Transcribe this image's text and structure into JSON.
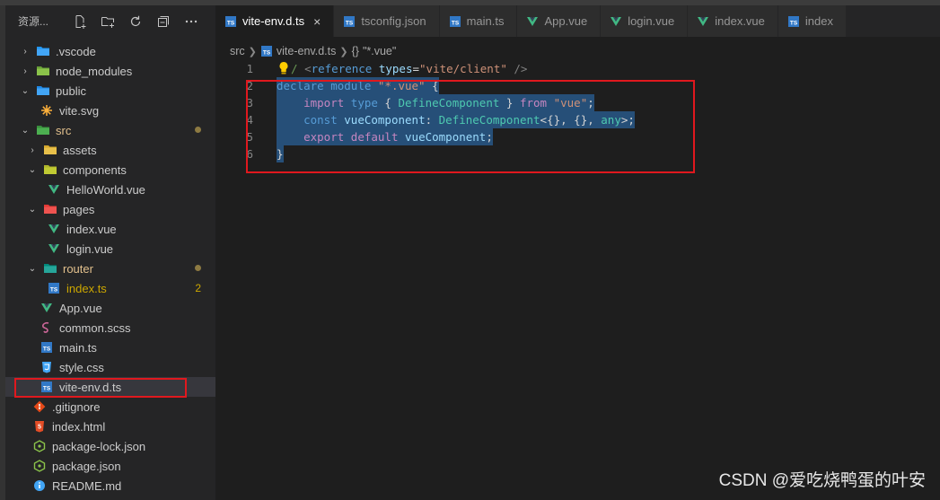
{
  "sidebar": {
    "title": "资源...",
    "tree": [
      {
        "label": ".vscode",
        "chev": "›",
        "depth": 0,
        "icon": "folder-vscode-icon",
        "status": ""
      },
      {
        "label": "node_modules",
        "chev": "›",
        "depth": 0,
        "icon": "folder-node-icon",
        "status": ""
      },
      {
        "label": "public",
        "chev": "⌄",
        "depth": 0,
        "icon": "folder-public-icon",
        "status": ""
      },
      {
        "label": "vite.svg",
        "chev": "",
        "depth": 1,
        "icon": "svg-file-icon",
        "status": ""
      },
      {
        "label": "src",
        "chev": "⌄",
        "depth": 0,
        "icon": "folder-src-icon",
        "status": "dot"
      },
      {
        "label": "assets",
        "chev": "›",
        "depth": 1,
        "icon": "folder-icon",
        "status": ""
      },
      {
        "label": "components",
        "chev": "⌄",
        "depth": 1,
        "icon": "folder-components-icon",
        "status": ""
      },
      {
        "label": "HelloWorld.vue",
        "chev": "",
        "depth": 2,
        "icon": "vue-file-icon",
        "status": ""
      },
      {
        "label": "pages",
        "chev": "⌄",
        "depth": 1,
        "icon": "folder-pages-icon",
        "status": ""
      },
      {
        "label": "index.vue",
        "chev": "",
        "depth": 2,
        "icon": "vue-file-icon",
        "status": ""
      },
      {
        "label": "login.vue",
        "chev": "",
        "depth": 2,
        "icon": "vue-file-icon",
        "status": ""
      },
      {
        "label": "router",
        "chev": "⌄",
        "depth": 1,
        "icon": "folder-router-icon",
        "status": "dot"
      },
      {
        "label": "index.ts",
        "chev": "",
        "depth": 2,
        "icon": "ts-file-icon",
        "status": "2"
      },
      {
        "label": "App.vue",
        "chev": "",
        "depth": 1,
        "icon": "vue-file-icon",
        "status": ""
      },
      {
        "label": "common.scss",
        "chev": "",
        "depth": 1,
        "icon": "scss-file-icon",
        "status": ""
      },
      {
        "label": "main.ts",
        "chev": "",
        "depth": 1,
        "icon": "ts-file-icon",
        "status": ""
      },
      {
        "label": "style.css",
        "chev": "",
        "depth": 1,
        "icon": "css-file-icon",
        "status": ""
      },
      {
        "label": "vite-env.d.ts",
        "chev": "",
        "depth": 1,
        "icon": "ts-file-icon",
        "status": "selected"
      },
      {
        "label": ".gitignore",
        "chev": "",
        "depth": 0,
        "icon": "git-file-icon",
        "status": ""
      },
      {
        "label": "index.html",
        "chev": "",
        "depth": 0,
        "icon": "html-file-icon",
        "status": ""
      },
      {
        "label": "package-lock.json",
        "chev": "",
        "depth": 0,
        "icon": "node-json-icon",
        "status": ""
      },
      {
        "label": "package.json",
        "chev": "",
        "depth": 0,
        "icon": "node-json-icon",
        "status": ""
      },
      {
        "label": "README.md",
        "chev": "",
        "depth": 0,
        "icon": "info-file-icon",
        "status": ""
      }
    ]
  },
  "tabs": [
    {
      "label": "vite-env.d.ts",
      "icon": "ts-file-icon",
      "active": true,
      "close": "×"
    },
    {
      "label": "tsconfig.json",
      "icon": "ts-file-icon",
      "active": false,
      "close": ""
    },
    {
      "label": "main.ts",
      "icon": "ts-file-icon",
      "active": false,
      "close": ""
    },
    {
      "label": "App.vue",
      "icon": "vue-file-icon",
      "active": false,
      "close": ""
    },
    {
      "label": "login.vue",
      "icon": "vue-file-icon",
      "active": false,
      "close": ""
    },
    {
      "label": "index.vue",
      "icon": "vue-file-icon",
      "active": false,
      "close": ""
    },
    {
      "label": "index",
      "icon": "ts-file-icon",
      "active": false,
      "close": ""
    }
  ],
  "breadcrumb": {
    "folder": "src",
    "file": "vite-env.d.ts",
    "symbol_icon": "{}",
    "symbol": "\"*.vue\""
  },
  "editor": {
    "lines": [
      {
        "n": "1",
        "tokens": [
          [
            "cm",
            "/ "
          ],
          [
            "tagc",
            "<"
          ],
          [
            "kw",
            "reference"
          ],
          [
            "punc",
            " "
          ],
          [
            "id",
            "types"
          ],
          [
            "punc",
            "="
          ],
          [
            "str",
            "\"vite/client\""
          ],
          [
            "punc",
            " "
          ],
          [
            "tagc",
            "/>"
          ]
        ],
        "selected": false
      },
      {
        "n": "2",
        "tokens": [
          [
            "kw",
            "declare"
          ],
          [
            "punc",
            " "
          ],
          [
            "kw",
            "module"
          ],
          [
            "punc",
            " "
          ],
          [
            "str",
            "\"*.vue\""
          ],
          [
            "punc",
            " {"
          ]
        ],
        "selected": true
      },
      {
        "n": "3",
        "tokens": [
          [
            "punc",
            "    "
          ],
          [
            "kw2",
            "import"
          ],
          [
            "punc",
            " "
          ],
          [
            "kw",
            "type"
          ],
          [
            "punc",
            " { "
          ],
          [
            "ty",
            "DefineComponent"
          ],
          [
            "punc",
            " } "
          ],
          [
            "kw2",
            "from"
          ],
          [
            "punc",
            " "
          ],
          [
            "str",
            "\"vue\""
          ],
          [
            "punc",
            ";"
          ]
        ],
        "selected": true
      },
      {
        "n": "4",
        "tokens": [
          [
            "punc",
            "    "
          ],
          [
            "kw",
            "const"
          ],
          [
            "punc",
            " "
          ],
          [
            "id",
            "vueComponent"
          ],
          [
            "punc",
            ": "
          ],
          [
            "ty",
            "DefineComponent"
          ],
          [
            "punc",
            "<{}, {}, "
          ],
          [
            "ty",
            "any"
          ],
          [
            "punc",
            ">;"
          ]
        ],
        "selected": true
      },
      {
        "n": "5",
        "tokens": [
          [
            "punc",
            "    "
          ],
          [
            "kw2",
            "export"
          ],
          [
            "punc",
            " "
          ],
          [
            "kw2",
            "default"
          ],
          [
            "punc",
            " "
          ],
          [
            "id",
            "vueComponent"
          ],
          [
            "punc",
            ";"
          ]
        ],
        "selected": true
      },
      {
        "n": "6",
        "tokens": [
          [
            "punc",
            "}"
          ]
        ],
        "selected": true
      }
    ]
  },
  "watermark": "CSDN @爱吃烧鸭蛋的叶安"
}
